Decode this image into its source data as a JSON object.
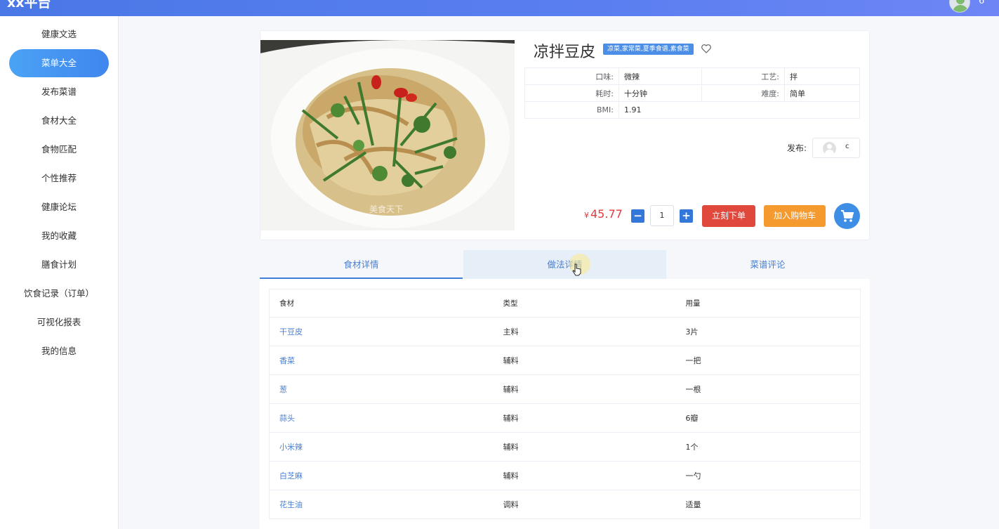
{
  "app": {
    "brand": "xx平台",
    "user_count": "6"
  },
  "sidebar": {
    "items": [
      {
        "label": "健康文选"
      },
      {
        "label": "菜单大全",
        "active": true
      },
      {
        "label": "发布菜谱"
      },
      {
        "label": "食材大全"
      },
      {
        "label": "食物匹配"
      },
      {
        "label": "个性推荐"
      },
      {
        "label": "健康论坛"
      },
      {
        "label": "我的收藏"
      },
      {
        "label": "膳食计划"
      },
      {
        "label": "饮食记录（订单）"
      },
      {
        "label": "可视化报表"
      },
      {
        "label": "我的信息"
      }
    ]
  },
  "dish": {
    "title": "凉拌豆皮",
    "tag": "凉菜,家常菜,夏季食谱,素食菜",
    "image_watermark": "美食天下",
    "props": {
      "taste_label": "口味:",
      "taste": "微辣",
      "craft_label": "工艺:",
      "craft": "拌",
      "time_label": "耗时:",
      "time": "十分钟",
      "difficulty_label": "难度:",
      "difficulty": "简单",
      "bmi_label": "BMI:",
      "bmi": "1.91"
    },
    "publish_label": "发布:",
    "publisher": "c",
    "currency": "¥",
    "price": "45.77",
    "quantity": "1",
    "minus_label": "−",
    "plus_label": "+",
    "order_button": "立刻下单",
    "cart_button": "加入购物车"
  },
  "tabs": [
    {
      "label": "食材详情",
      "active": true
    },
    {
      "label": "做法详情",
      "hover": true
    },
    {
      "label": "菜谱评论"
    }
  ],
  "ingredients": {
    "columns": [
      "食材",
      "类型",
      "用量"
    ],
    "rows": [
      {
        "name": "干豆皮",
        "type": "主料",
        "amount": "3片"
      },
      {
        "name": "香菜",
        "type": "辅料",
        "amount": "一把"
      },
      {
        "name": "葱",
        "type": "辅料",
        "amount": "一根"
      },
      {
        "name": "蒜头",
        "type": "辅料",
        "amount": "6瓣"
      },
      {
        "name": "小米辣",
        "type": "辅料",
        "amount": "1个"
      },
      {
        "name": "白芝麻",
        "type": "辅料",
        "amount": "一勺"
      },
      {
        "name": "花生油",
        "type": "调料",
        "amount": "适量"
      }
    ]
  },
  "colors": {
    "accent": "#3f86ee",
    "price": "#e4393c",
    "order": "#e0483b",
    "cart": "#f59a2e",
    "link": "#4a7fd0"
  },
  "icons": {
    "heart": "heart-icon",
    "cart": "cart-icon",
    "avatar": "avatar-icon",
    "cursor": "pointer-cursor-icon"
  }
}
